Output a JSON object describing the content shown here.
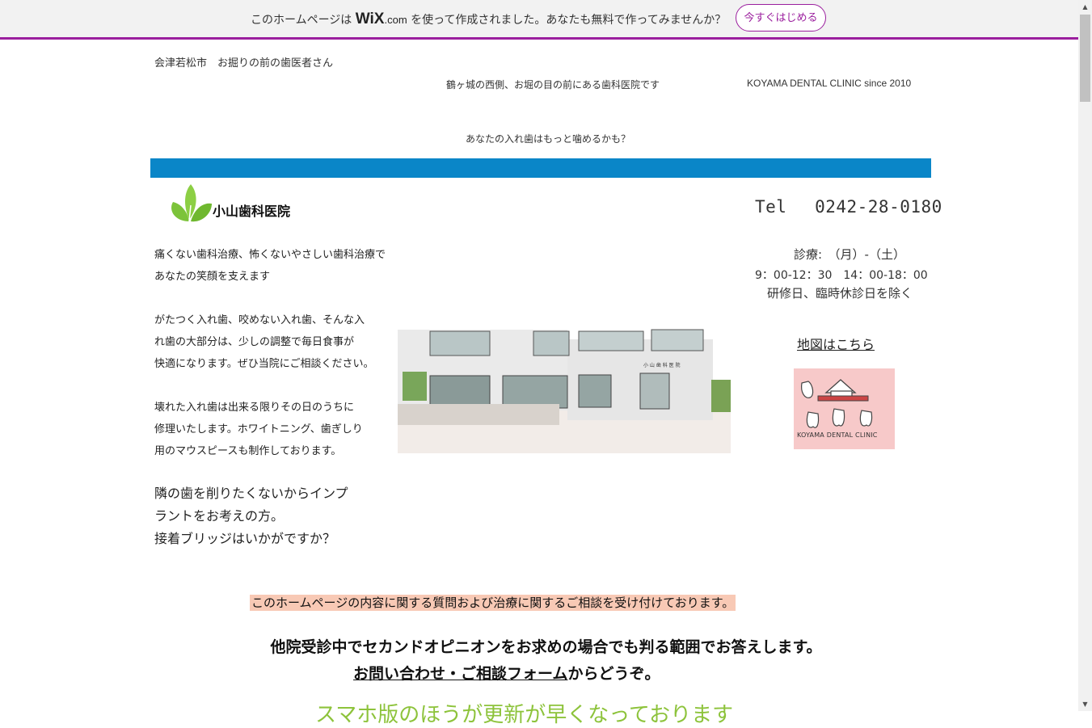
{
  "wix_banner": {
    "prefix": "このホームページは",
    "logo": "WiX",
    "logo_suffix": ".com",
    "suffix": "を使って作成されました。あなたも無料で作ってみませんか？",
    "button": "今すぐはじめる"
  },
  "header": {
    "tagline_top": "会津若松市　お掘りの前の歯医者さん",
    "location": "鶴ヶ城の西側、お堀の目の前にある歯科医院です",
    "english": "KOYAMA  DENTAL  CLINIC since 2010",
    "question": "あなたの入れ歯はもっと噛めるかも？"
  },
  "clinic": {
    "name": "小山歯科医院",
    "tel": "Tel　 0242-28-0180",
    "hours_label": "診療:　（月）-（土）",
    "hours_time": "9：00-12：30　14：00-18：00",
    "hours_note": "研修日、臨時休診日を除く",
    "map_link": "地図はこちら",
    "logo_text": "KOYAMA DENTAL CLINIC"
  },
  "body_text": {
    "p1_l1": "痛くない歯科治療、怖くないやさしい歯科治療で",
    "p1_l2": "あなたの笑顔を支えます",
    "p2_l1": "がたつく入れ歯、咬めない入れ歯、そんな入",
    "p2_l2": "れ歯の大部分は、少しの調整で毎日食事が",
    "p2_l3": "快適になります。ぜひ当院にご相談ください。",
    "p3_l1": "壊れた入れ歯は出来る限りその日のうちに",
    "p3_l2": "修理いたします。ホワイトニング、歯ぎしり",
    "p3_l3": "用のマウスピースも制作しております。",
    "p4_l1": "隣の歯を削りたくないからインプ",
    "p4_l2": "ラントをお考えの方。",
    "p4_l3": "接着ブリッジはいかがですか？"
  },
  "contact": {
    "notice": "このホームページの内容に関する質問および治療に関するご相談を受け付けております。",
    "second_opinion": "他院受診中でセカンドオピニオンをお求めの場合でも判る範囲でお答えします。",
    "form_link": "お問い合わせ・ご相談フォーム",
    "form_suffix": "からどうぞ。",
    "green_notice": "スマホ版のほうが更新が早くなっております"
  },
  "building_sign": "小 山 歯 科 医 院",
  "colors": {
    "accent_bar": "#0a86c8",
    "wix_purple": "#9b1f9e",
    "notice_bg": "#f8c9b5",
    "green_text": "#8dc33b"
  }
}
